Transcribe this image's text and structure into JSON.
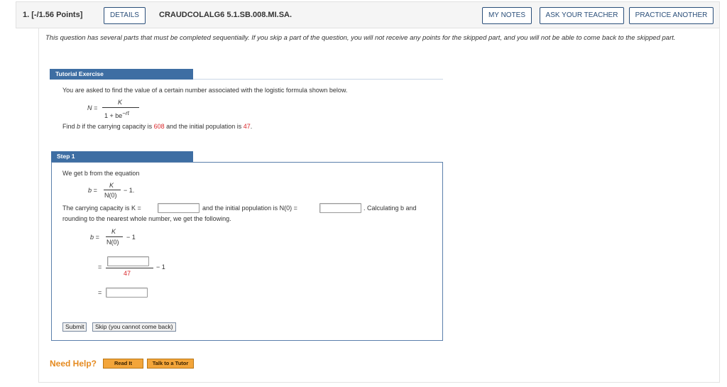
{
  "header": {
    "question_number": "1.",
    "points": "[-/1.56 Points]",
    "details_label": "DETAILS",
    "question_id": "CRAUDCOLALG6 5.1.SB.008.MI.SA.",
    "my_notes_label": "MY NOTES",
    "ask_teacher_label": "ASK YOUR TEACHER",
    "practice_another_label": "PRACTICE ANOTHER"
  },
  "notice": "This question has several parts that must be completed sequentially. If you skip a part of the question, you will not receive any points for the skipped part, and you will not be able to come back to the skipped part.",
  "tutorial": {
    "heading": "Tutorial Exercise",
    "intro": "You are asked to find the value of a certain number associated with the logistic formula shown below.",
    "formula_lhs": "N =",
    "formula_num": "K",
    "formula_den": "1 + be",
    "formula_exp": "−rt",
    "find_prefix": "Find",
    "find_var": "b",
    "find_mid": "if the carrying capacity is",
    "capacity": "608",
    "find_mid2": "and the initial population is",
    "initial_pop": "47",
    "find_end": "."
  },
  "step1": {
    "heading": "Step 1",
    "line1": "We get b from the equation",
    "eq_lhs": "b =",
    "eq_num": "K",
    "eq_den": "N(0)",
    "eq_tail": "− 1.",
    "sentence_a": "The carrying capacity is K =",
    "sentence_b": "and the initial population is N(0) =",
    "sentence_c": ". Calculating b and",
    "sentence_d": "rounding to the nearest whole number, we get the following.",
    "work_lhs": "b =",
    "work_num": "K",
    "work_den": "N(0)",
    "work_tail": "− 1",
    "eq_sign": "=",
    "denominator_value": "47",
    "minus_one": "− 1",
    "eq_sign2": "=",
    "submit_label": "Submit",
    "skip_label": "Skip (you cannot come back)"
  },
  "help": {
    "label": "Need Help?",
    "read_it": "Read It",
    "talk_tutor": "Talk to a Tutor"
  },
  "colors": {
    "accent_blue": "#3e6ea3",
    "red_value": "#d9262a",
    "help_orange": "#e58a1f",
    "button_orange": "#f3a53a"
  }
}
